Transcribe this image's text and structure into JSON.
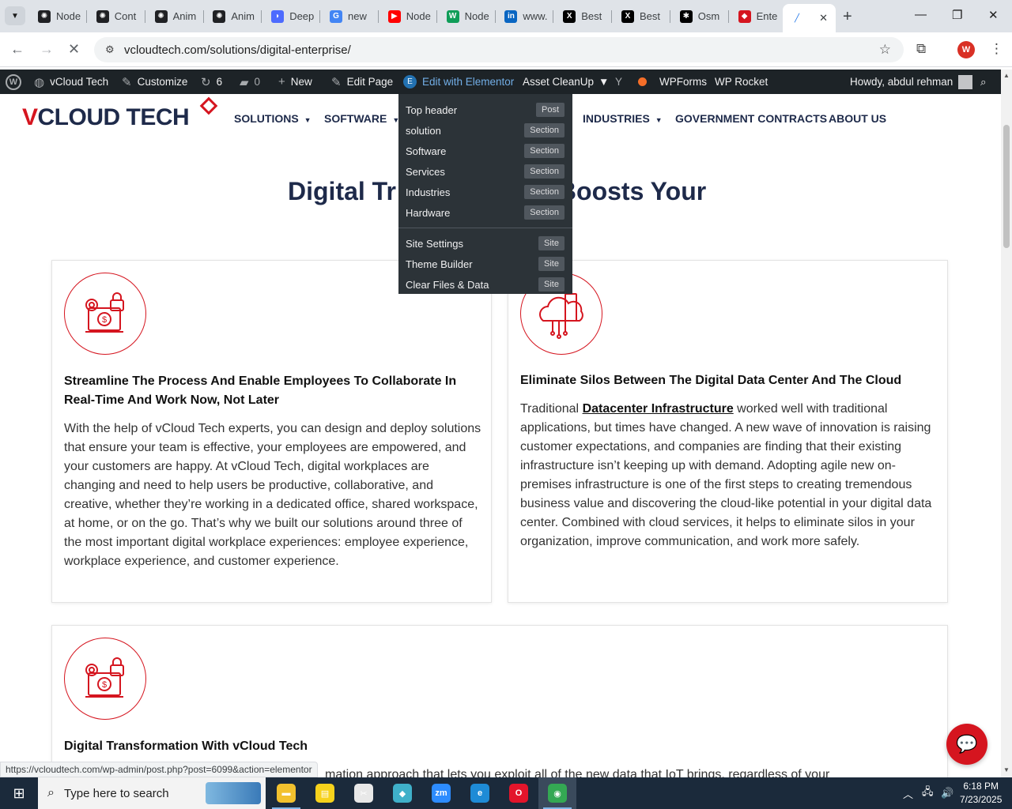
{
  "browser": {
    "tabs": [
      {
        "label": "Node",
        "favicon": "openai-icon",
        "color": "#202124"
      },
      {
        "label": "Cont",
        "favicon": "openai-icon",
        "color": "#202124"
      },
      {
        "label": "Anim",
        "favicon": "openai-icon",
        "color": "#202124"
      },
      {
        "label": "Anim",
        "favicon": "openai-icon",
        "color": "#202124"
      },
      {
        "label": "Deep",
        "favicon": "deepseek-icon",
        "color": "#4d6bfe"
      },
      {
        "label": "new",
        "favicon": "google-icon",
        "color": "#4285f4"
      },
      {
        "label": "Node",
        "favicon": "youtube-icon",
        "color": "#ff0000"
      },
      {
        "label": "Node",
        "favicon": "w-icon",
        "color": "#0f9d58"
      },
      {
        "label": "www.",
        "favicon": "linkedin-icon",
        "color": "#0a66c2"
      },
      {
        "label": "Best",
        "favicon": "x-icon",
        "color": "#000000"
      },
      {
        "label": "Best",
        "favicon": "x-icon",
        "color": "#000000"
      },
      {
        "label": "Osm",
        "favicon": "osmo-icon",
        "color": "#000000"
      },
      {
        "label": "Ente",
        "favicon": "enterprise-icon",
        "color": "#d5151f"
      }
    ],
    "active_tab_label": "",
    "url": "vcloudtech.com/solutions/digital-enterprise/",
    "profile_initial": "W"
  },
  "adminbar": {
    "site_name": "vCloud Tech",
    "customize": "Customize",
    "updates_count": "6",
    "comments_count": "0",
    "new": "New",
    "edit_page": "Edit Page",
    "edit_elementor": "Edit with Elementor",
    "asset_cleanup": "Asset CleanUp",
    "wpforms": "WPForms",
    "wp_rocket": "WP Rocket",
    "howdy": "Howdy, abdul rehman"
  },
  "elementor_menu": [
    {
      "label": "Top header",
      "badge": "Post"
    },
    {
      "label": "solution",
      "badge": "Section"
    },
    {
      "label": "Software",
      "badge": "Section"
    },
    {
      "label": "Services",
      "badge": "Section"
    },
    {
      "label": "Industries",
      "badge": "Section"
    },
    {
      "label": "Hardware",
      "badge": "Section"
    },
    {
      "label": "Site Settings",
      "badge": "Site"
    },
    {
      "label": "Theme Builder",
      "badge": "Site"
    },
    {
      "label": "Clear Files & Data",
      "badge": "Site"
    }
  ],
  "site": {
    "logo_v": "V",
    "logo_rest": "CLOUD TECH",
    "nav": {
      "solutions": "SOLUTIONS",
      "software": "SOFTWARE",
      "industries": "INDUSTRIES",
      "government": "GOVERNMENT CONTRACTS",
      "about": "ABOUT US"
    },
    "title_left": "Digital Tr",
    "title_right": "Boosts Your"
  },
  "cards": {
    "card1": {
      "heading": "Streamline The Process And Enable Employees To Collaborate In Real-Time And Work Now, Not Later",
      "body": "With the help of vCloud Tech experts, you can design and deploy solutions that ensure your team is effective, your employees are empowered, and your customers are happy. At vCloud Tech, digital workplaces are changing and need to help users be productive, collaborative, and creative, whether they’re working in a dedicated office, shared workspace, at home, or on the go. That’s why we built our solutions around three of the most important digital workplace experiences: employee experience, workplace experience, and customer experience."
    },
    "card2": {
      "heading": "Eliminate Silos Between The Digital Data Center And The Cloud",
      "body_pre": "Traditional ",
      "link": "Datacenter Infrastructure",
      "body_post": " worked well with traditional applications, but times have changed. A new wave of innovation is raising customer expectations, and companies are finding that their existing infrastructure isn’t keeping up with demand. Adopting agile new on-premises infrastructure is one of the first steps to creating tremendous business value and discovering the cloud-like potential in your digital data center. Combined with cloud services, it helps to eliminate silos in your organization, improve communication, and work more safely."
    },
    "card3": {
      "heading": "Digital Transformation With vCloud Tech",
      "body_partial": "mation approach that lets you exploit all of the new data that IoT brings, regardless of your"
    }
  },
  "status_url": "https://vcloudtech.com/wp-admin/post.php?post=6099&action=elementor",
  "taskbar": {
    "search_placeholder": "Type here to search",
    "time": "6:18 PM",
    "date": "7/23/2025",
    "apps": [
      {
        "name": "file-explorer-icon",
        "color": "#f2c12e"
      },
      {
        "name": "sticky-notes-icon",
        "color": "#f7d21c"
      },
      {
        "name": "snipping-tool-icon",
        "color": "#e8e8e8"
      },
      {
        "name": "app-diamond-icon",
        "color": "#3fb0c9"
      },
      {
        "name": "zoom-icon",
        "color": "#2d8cff"
      },
      {
        "name": "edge-icon",
        "color": "#1e8bd6"
      },
      {
        "name": "opera-icon",
        "color": "#e3152b"
      },
      {
        "name": "chrome-icon",
        "color": "#34a853"
      }
    ]
  },
  "colors": {
    "brand_red": "#d5151f",
    "navy": "#1e2a4a",
    "adminbar": "#1d2327"
  }
}
